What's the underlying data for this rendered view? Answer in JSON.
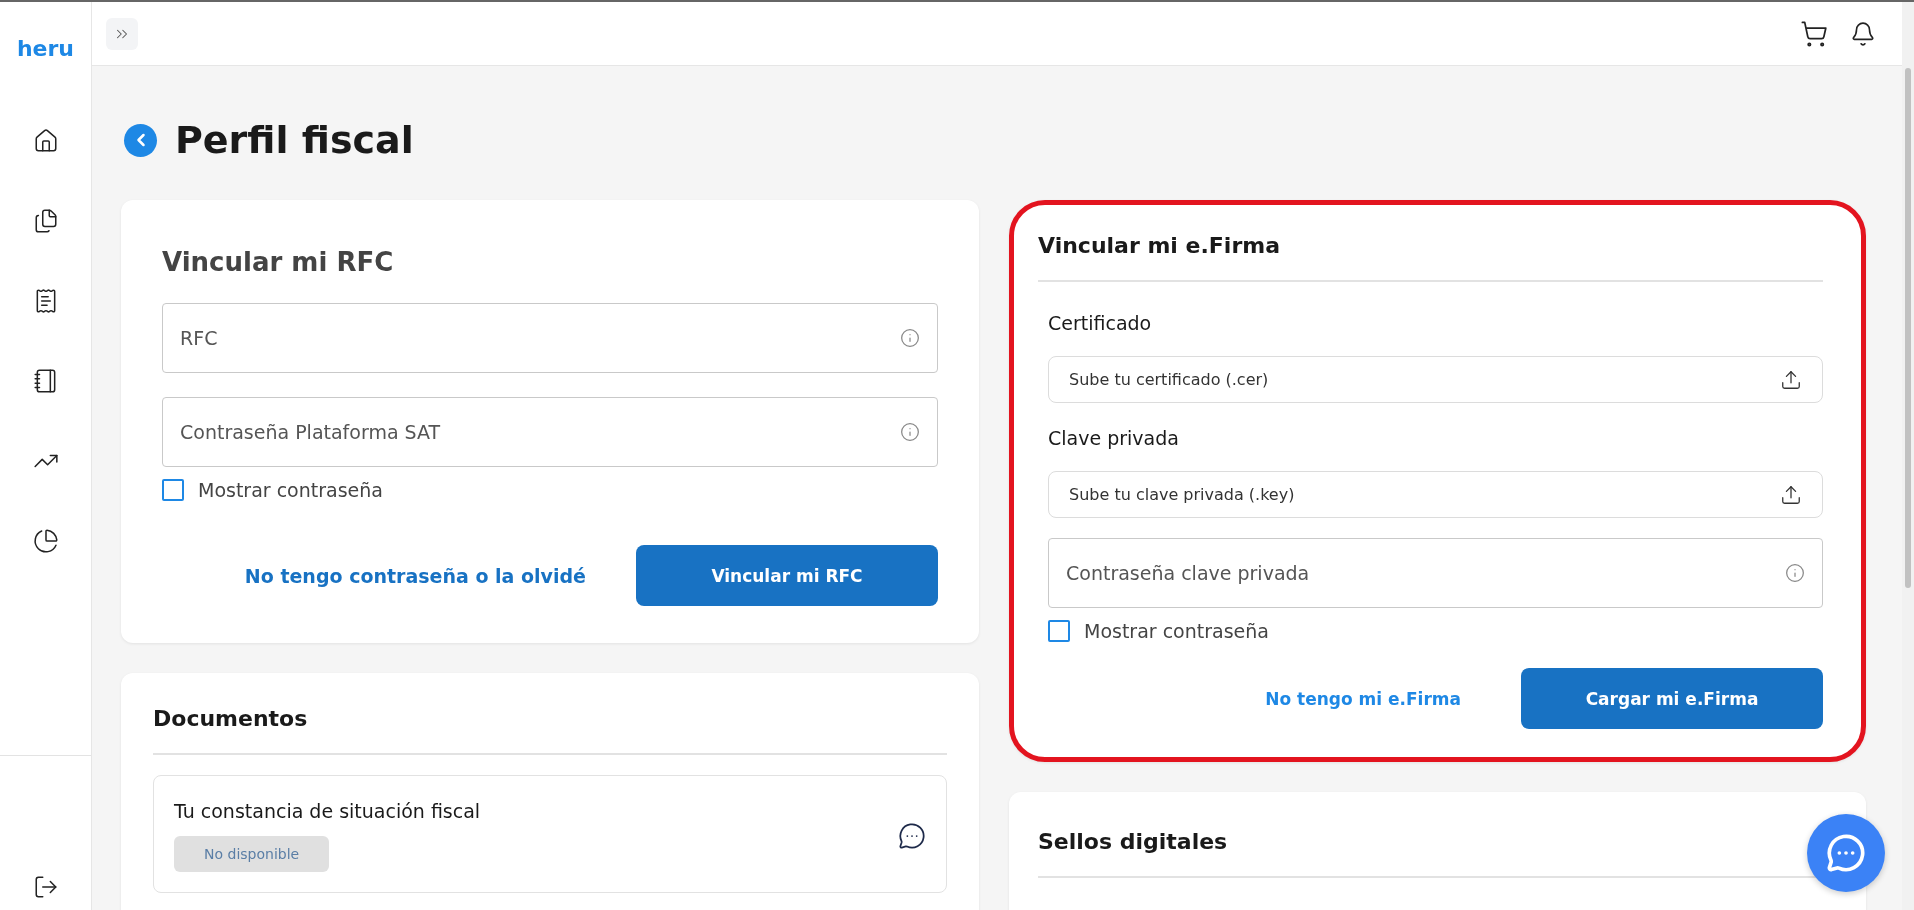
{
  "brand": "heru",
  "sidebar": {
    "items": [
      {
        "kind": "home",
        "selected": false
      },
      {
        "kind": "documents",
        "selected": false
      },
      {
        "kind": "receipt",
        "selected": false
      },
      {
        "kind": "note",
        "selected": false
      },
      {
        "kind": "chart",
        "selected": false
      },
      {
        "kind": "pie",
        "selected": false
      }
    ]
  },
  "page": {
    "title": "Perfil fiscal"
  },
  "rfc_card": {
    "title": "Vincular mi RFC",
    "fields": [
      {
        "placeholder": "RFC"
      },
      {
        "placeholder": "Contraseña Plataforma SAT"
      }
    ],
    "show_password": {
      "label": "Mostrar contraseña",
      "checked": false
    },
    "link": "No tengo contraseña o la olvidé",
    "button": "Vincular mi RFC"
  },
  "documents_card": {
    "title": "Documentos",
    "items": [
      {
        "title": "Tu constancia de situación fiscal",
        "status": "No disponible"
      }
    ]
  },
  "efirma_card": {
    "title": "Vincular mi e.Firma",
    "highlighted": true,
    "certificate": {
      "label": "Certificado",
      "upload": "Sube tu certificado (.cer)"
    },
    "private_key": {
      "label": "Clave privada",
      "upload": "Sube tu clave privada (.key)"
    },
    "password": {
      "placeholder": "Contraseña clave privada"
    },
    "show_password": {
      "label": "Mostrar contraseña",
      "checked": false
    },
    "link": "No tengo mi e.Firma",
    "button": "Cargar mi e.Firma"
  },
  "seals_card": {
    "title": "Sellos digitales"
  }
}
